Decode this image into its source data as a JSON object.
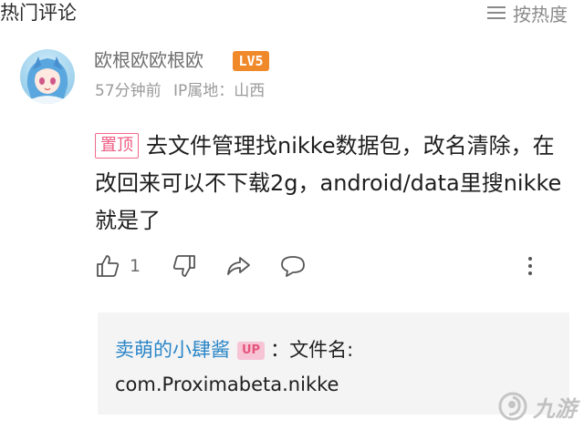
{
  "header": {
    "title": "热门评论",
    "sort_label": "按热度"
  },
  "comment": {
    "username": "欧根欧欧根欧",
    "level": "LV5",
    "time": "57分钟前",
    "ip_location": "IP属地：山西",
    "pin_tag": "置顶",
    "text": "去文件管理找nikke数据包，改名清除，在改回来可以不下载2g，android/data里搜nikke就是了",
    "like_count": "1"
  },
  "reply": {
    "username": "卖萌的小肆酱",
    "badge": "UP",
    "separator": "：",
    "text_line1": "文件名:",
    "text_line2": "com.Proximabeta.nikke"
  },
  "watermark": {
    "text": "九游"
  },
  "colors": {
    "level_badge": "#f0892a",
    "pin_tag": "#ef5b82",
    "reply_user": "#2a86c8",
    "up_badge_bg": "#f7c4d6",
    "reply_bg": "#f4f4f4"
  }
}
